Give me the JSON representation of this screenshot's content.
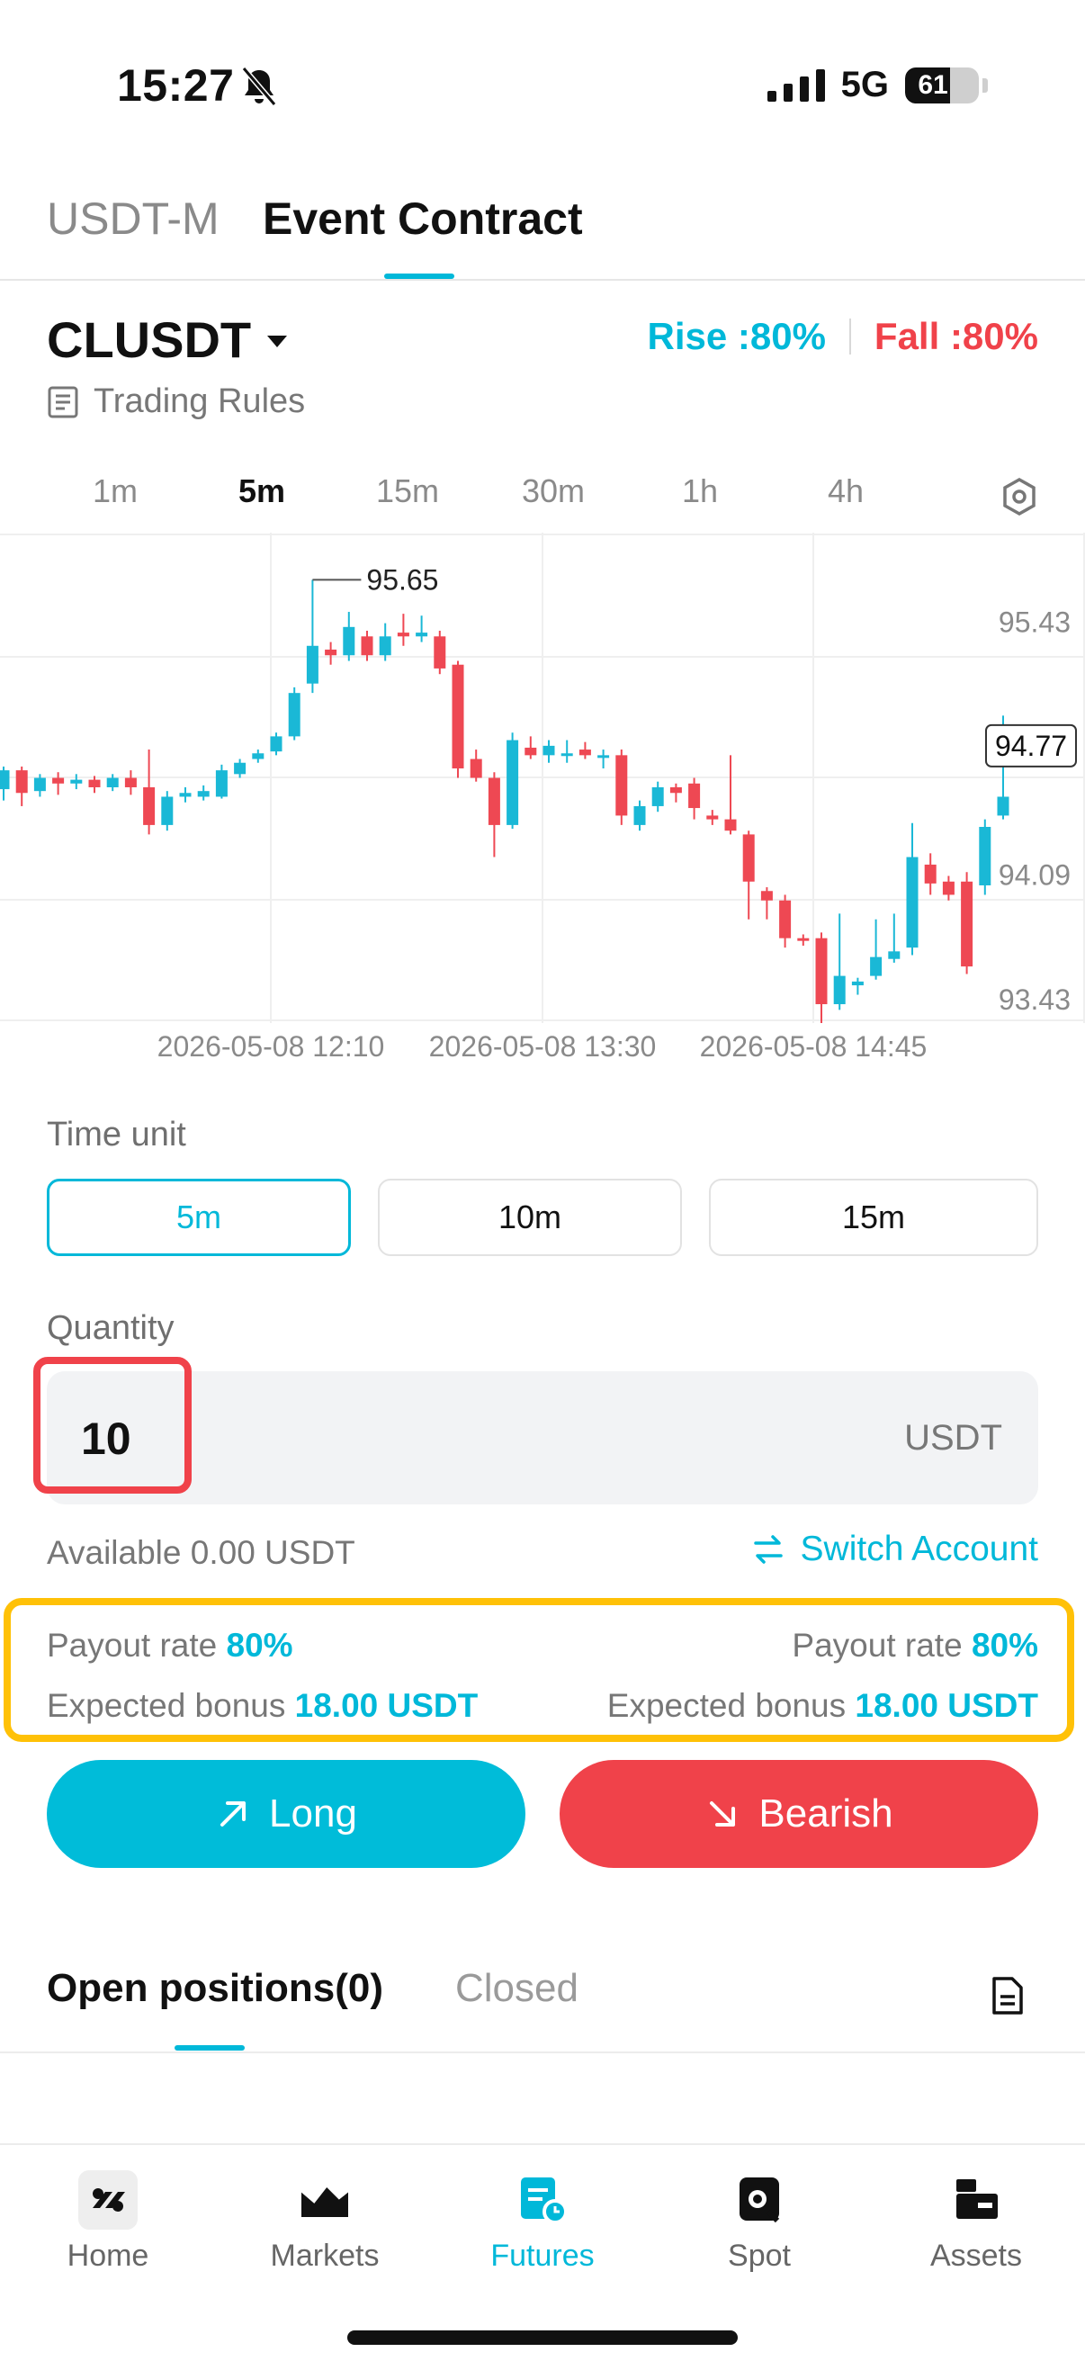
{
  "status_bar": {
    "time": "15:27",
    "network": "5G",
    "battery": "61",
    "battery_level": 0.61
  },
  "top_tabs": [
    {
      "label": "USDT-M",
      "active": false
    },
    {
      "label": "Event Contract",
      "active": true
    }
  ],
  "instrument": {
    "symbol": "CLUSDT",
    "rise_label": "Rise :80%",
    "fall_label": "Fall :80%",
    "rules_label": "Trading Rules"
  },
  "timeframes": [
    {
      "label": "1m",
      "active": false
    },
    {
      "label": "5m",
      "active": true
    },
    {
      "label": "15m",
      "active": false
    },
    {
      "label": "30m",
      "active": false
    },
    {
      "label": "1h",
      "active": false
    },
    {
      "label": "4h",
      "active": false
    }
  ],
  "chart_data": {
    "type": "candlestick",
    "x_labels": [
      "2026-05-08 12:10",
      "2026-05-08 13:30",
      "2026-05-08 14:45"
    ],
    "y_labels": [
      "95.43",
      "94.09",
      "93.43"
    ],
    "last_price": "94.77",
    "high_label": "95.65",
    "low_label": "93.43",
    "ylim": [
      93.3,
      95.9
    ],
    "up_color": "#1ab8d6",
    "down_color": "#ee4853",
    "candles": [
      {
        "o": 94.54,
        "c": 94.64,
        "h": 94.66,
        "l": 94.48
      },
      {
        "o": 94.64,
        "c": 94.52,
        "h": 94.66,
        "l": 94.45
      },
      {
        "o": 94.53,
        "c": 94.6,
        "h": 94.62,
        "l": 94.5
      },
      {
        "o": 94.6,
        "c": 94.57,
        "h": 94.63,
        "l": 94.51
      },
      {
        "o": 94.57,
        "c": 94.59,
        "h": 94.62,
        "l": 94.54
      },
      {
        "o": 94.59,
        "c": 94.55,
        "h": 94.61,
        "l": 94.52
      },
      {
        "o": 94.55,
        "c": 94.6,
        "h": 94.62,
        "l": 94.53
      },
      {
        "o": 94.6,
        "c": 94.55,
        "h": 94.64,
        "l": 94.51
      },
      {
        "o": 94.55,
        "c": 94.35,
        "h": 94.75,
        "l": 94.3
      },
      {
        "o": 94.35,
        "c": 94.5,
        "h": 94.53,
        "l": 94.32
      },
      {
        "o": 94.5,
        "c": 94.52,
        "h": 94.55,
        "l": 94.47
      },
      {
        "o": 94.5,
        "c": 94.53,
        "h": 94.56,
        "l": 94.48
      },
      {
        "o": 94.5,
        "c": 94.64,
        "h": 94.67,
        "l": 94.49
      },
      {
        "o": 94.62,
        "c": 94.68,
        "h": 94.7,
        "l": 94.6
      },
      {
        "o": 94.7,
        "c": 94.73,
        "h": 94.75,
        "l": 94.68
      },
      {
        "o": 94.74,
        "c": 94.82,
        "h": 94.84,
        "l": 94.72
      },
      {
        "o": 94.82,
        "c": 95.05,
        "h": 95.08,
        "l": 94.8
      },
      {
        "o": 95.1,
        "c": 95.3,
        "h": 95.65,
        "l": 95.05
      },
      {
        "o": 95.28,
        "c": 95.25,
        "h": 95.32,
        "l": 95.2
      },
      {
        "o": 95.25,
        "c": 95.4,
        "h": 95.48,
        "l": 95.22
      },
      {
        "o": 95.35,
        "c": 95.25,
        "h": 95.38,
        "l": 95.22
      },
      {
        "o": 95.25,
        "c": 95.35,
        "h": 95.42,
        "l": 95.22
      },
      {
        "o": 95.37,
        "c": 95.35,
        "h": 95.47,
        "l": 95.3
      },
      {
        "o": 95.35,
        "c": 95.37,
        "h": 95.46,
        "l": 95.32
      },
      {
        "o": 95.35,
        "c": 95.18,
        "h": 95.38,
        "l": 95.15
      },
      {
        "o": 95.2,
        "c": 94.65,
        "h": 95.22,
        "l": 94.6
      },
      {
        "o": 94.7,
        "c": 94.6,
        "h": 94.75,
        "l": 94.58
      },
      {
        "o": 94.6,
        "c": 94.35,
        "h": 94.63,
        "l": 94.18
      },
      {
        "o": 94.35,
        "c": 94.8,
        "h": 94.84,
        "l": 94.33
      },
      {
        "o": 94.76,
        "c": 94.72,
        "h": 94.82,
        "l": 94.7
      },
      {
        "o": 94.72,
        "c": 94.77,
        "h": 94.8,
        "l": 94.68
      },
      {
        "o": 94.72,
        "c": 94.73,
        "h": 94.8,
        "l": 94.68
      },
      {
        "o": 94.75,
        "c": 94.72,
        "h": 94.79,
        "l": 94.7
      },
      {
        "o": 94.72,
        "c": 94.72,
        "h": 94.75,
        "l": 94.65
      },
      {
        "o": 94.72,
        "c": 94.4,
        "h": 94.75,
        "l": 94.35
      },
      {
        "o": 94.35,
        "c": 94.45,
        "h": 94.48,
        "l": 94.32
      },
      {
        "o": 94.45,
        "c": 94.55,
        "h": 94.58,
        "l": 94.42
      },
      {
        "o": 94.55,
        "c": 94.52,
        "h": 94.57,
        "l": 94.47
      },
      {
        "o": 94.57,
        "c": 94.44,
        "h": 94.6,
        "l": 94.38
      },
      {
        "o": 94.4,
        "c": 94.38,
        "h": 94.43,
        "l": 94.35
      },
      {
        "o": 94.38,
        "c": 94.32,
        "h": 94.72,
        "l": 94.3
      },
      {
        "o": 94.3,
        "c": 94.05,
        "h": 94.32,
        "l": 93.85
      },
      {
        "o": 94.0,
        "c": 93.95,
        "h": 94.02,
        "l": 93.85
      },
      {
        "o": 93.95,
        "c": 93.75,
        "h": 93.98,
        "l": 93.7
      },
      {
        "o": 93.75,
        "c": 93.74,
        "h": 93.77,
        "l": 93.71
      },
      {
        "o": 93.75,
        "c": 93.4,
        "h": 93.78,
        "l": 93.15
      },
      {
        "o": 93.4,
        "c": 93.55,
        "h": 93.88,
        "l": 93.37
      },
      {
        "o": 93.5,
        "c": 93.52,
        "h": 93.54,
        "l": 93.45
      },
      {
        "o": 93.55,
        "c": 93.65,
        "h": 93.85,
        "l": 93.53
      },
      {
        "o": 93.64,
        "c": 93.68,
        "h": 93.88,
        "l": 93.62
      },
      {
        "o": 93.7,
        "c": 94.18,
        "h": 94.36,
        "l": 93.66
      },
      {
        "o": 94.14,
        "c": 94.04,
        "h": 94.2,
        "l": 93.98
      },
      {
        "o": 94.05,
        "c": 93.98,
        "h": 94.08,
        "l": 93.95
      },
      {
        "o": 94.05,
        "c": 93.6,
        "h": 94.1,
        "l": 93.56
      },
      {
        "o": 94.03,
        "c": 94.34,
        "h": 94.38,
        "l": 93.98
      },
      {
        "o": 94.4,
        "c": 94.5,
        "h": 94.93,
        "l": 94.38
      }
    ]
  },
  "time_unit": {
    "label": "Time unit",
    "options": [
      {
        "label": "5m",
        "active": true
      },
      {
        "label": "10m",
        "active": false
      },
      {
        "label": "15m",
        "active": false
      }
    ]
  },
  "quantity": {
    "label": "Quantity",
    "value": "10",
    "unit": "USDT"
  },
  "account": {
    "available": "Available 0.00 USDT",
    "switch_label": "Switch Account"
  },
  "payout": {
    "left": {
      "rate_label": "Payout rate",
      "rate_value": "80%",
      "bonus_label": "Expected bonus",
      "bonus_value": "18.00 USDT"
    },
    "right": {
      "rate_label": "Payout rate",
      "rate_value": "80%",
      "bonus_label": "Expected bonus",
      "bonus_value": "18.00 USDT"
    }
  },
  "actions": {
    "long_label": "Long",
    "bearish_label": "Bearish"
  },
  "positions_tabs": {
    "open_label": "Open positions(0)",
    "closed_label": "Closed"
  },
  "bottom_nav": [
    {
      "label": "Home",
      "icon": "home-icon",
      "active": false
    },
    {
      "label": "Markets",
      "icon": "markets-icon",
      "active": false
    },
    {
      "label": "Futures",
      "icon": "futures-icon",
      "active": true
    },
    {
      "label": "Spot",
      "icon": "spot-icon",
      "active": false
    },
    {
      "label": "Assets",
      "icon": "assets-icon",
      "active": false
    }
  ],
  "colors": {
    "accent": "#00b8d9",
    "rise": "#00b8d9",
    "fall": "#f0424a",
    "highlight": "#ffc107"
  }
}
